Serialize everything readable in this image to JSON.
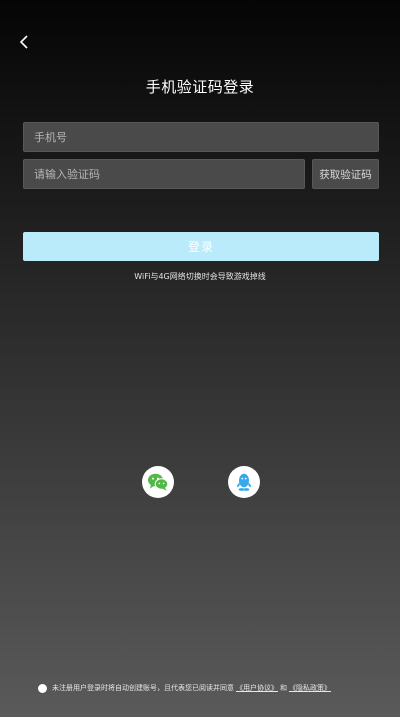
{
  "header": {
    "back_icon": "chevron-left-icon",
    "title": "手机验证码登录"
  },
  "form": {
    "phone_placeholder": "手机号",
    "phone_value": "",
    "code_placeholder": "请输入验证码",
    "code_value": "",
    "get_code_label": "获取验证码",
    "login_label": "登录",
    "login_color": "#b9ebfb"
  },
  "tip": "WiFi与4G网络切换时会导致游戏掉线",
  "social": {
    "wechat_icon": "wechat-icon",
    "wechat_color": "#52b848",
    "qq_icon": "qq-icon",
    "qq_color": "#35a9ea"
  },
  "agreement": {
    "text": "未注册用户登录时将自动创建账号，且代表您已阅读并同意",
    "user_agreement": "《用户协议》",
    "conjunction": "和",
    "privacy_policy": "《隐私政策》"
  }
}
